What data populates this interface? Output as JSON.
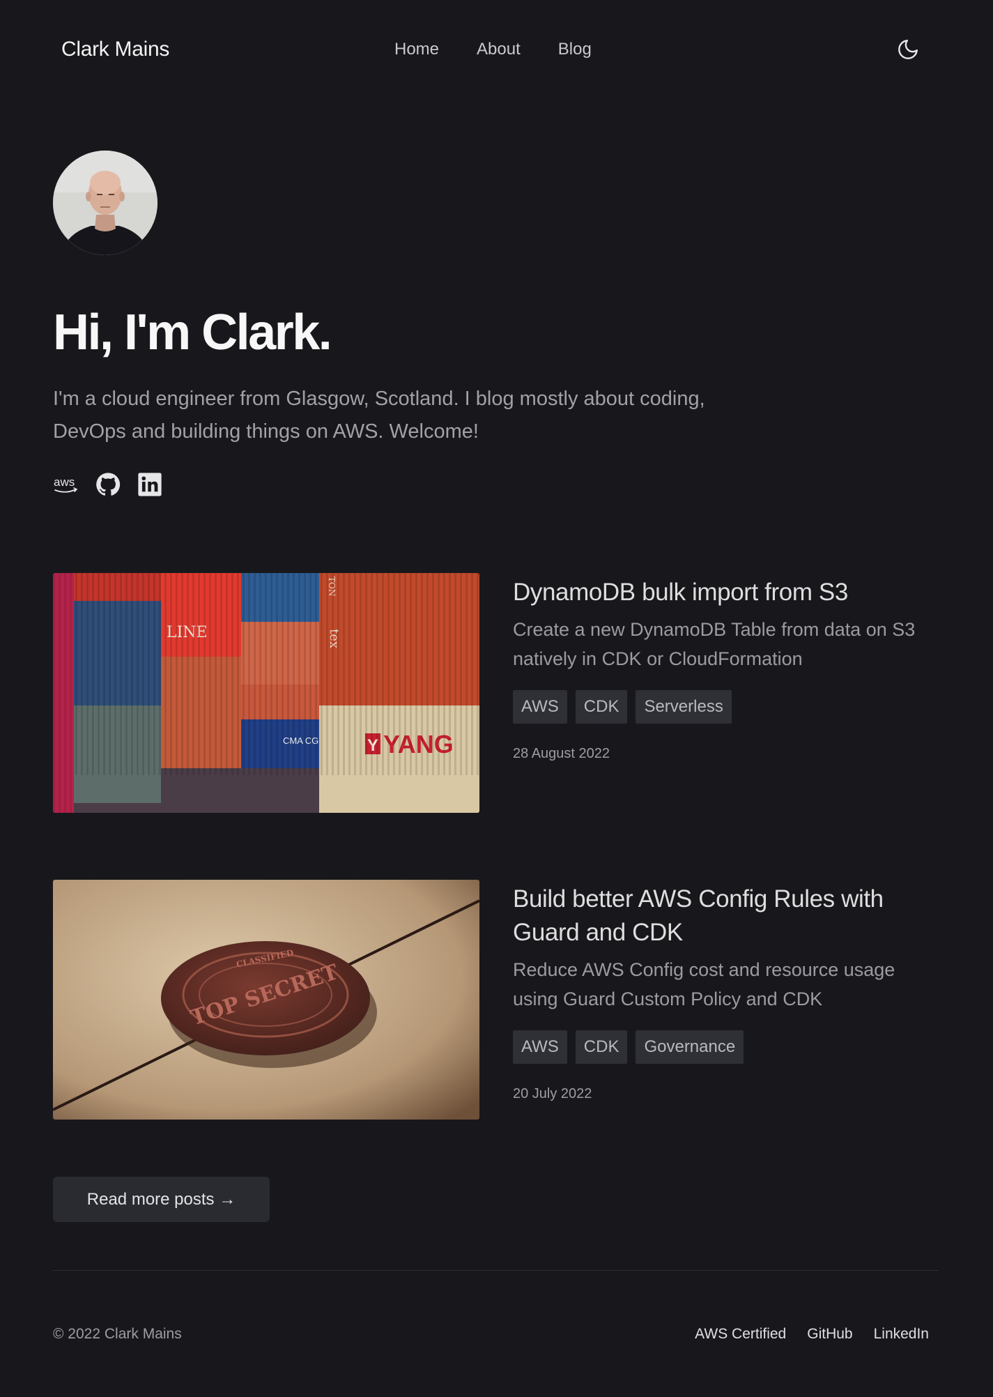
{
  "header": {
    "brand": "Clark Mains",
    "nav": [
      "Home",
      "About",
      "Blog"
    ]
  },
  "hero": {
    "title": "Hi, I'm Clark.",
    "intro": "I'm a cloud engineer from Glasgow, Scotland. I blog mostly about coding, DevOps and building things on AWS. Welcome!",
    "socials": [
      {
        "name": "AWS",
        "icon": "aws-icon"
      },
      {
        "name": "GitHub",
        "icon": "github-icon"
      },
      {
        "name": "LinkedIn",
        "icon": "linkedin-icon"
      }
    ]
  },
  "posts": [
    {
      "title": "DynamoDB bulk import from S3",
      "description": "Create a new DynamoDB Table from data on S3 natively in CDK or CloudFormation",
      "tags": [
        "AWS",
        "CDK",
        "Serverless"
      ],
      "date": "28 August 2022",
      "image": "shipping-containers-photo",
      "image_text": {
        "line": "LINE",
        "yang": "YANG",
        "yang_letter": "Y",
        "cma": "CMA CG",
        "ton": "TON",
        "tex": "tex"
      }
    },
    {
      "title": "Build better AWS Config Rules with Guard and CDK",
      "description": "Reduce AWS Config cost and resource usage using Guard Custom Policy and CDK",
      "tags": [
        "AWS",
        "CDK",
        "Governance"
      ],
      "date": "20 July 2022",
      "image": "wax-seal-top-secret-photo",
      "image_text": {
        "seal": "TOP SECRET",
        "ring": "CLASSIFIED"
      }
    }
  ],
  "read_more": "Read more posts →",
  "footer": {
    "copyright": "© 2022 Clark Mains",
    "links": [
      "AWS Certified",
      "GitHub",
      "LinkedIn"
    ]
  },
  "colors": {
    "background": "#18181c",
    "tag_bg": "#2f3036",
    "button_bg": "#2a2b30"
  }
}
